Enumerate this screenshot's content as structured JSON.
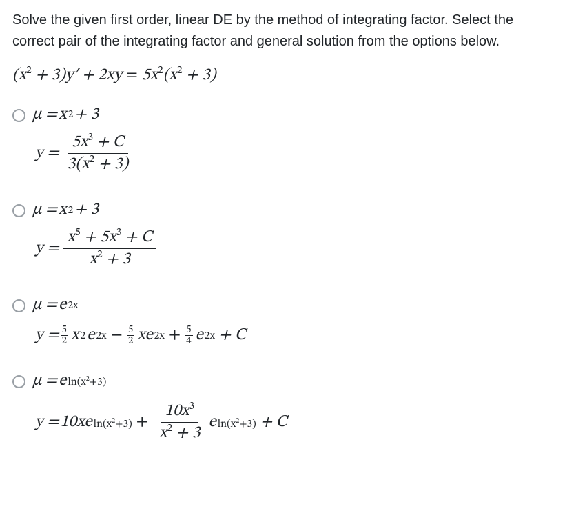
{
  "question": {
    "line1": "Solve the given first order, linear DE by the method of integrating factor. Select the",
    "line2": "correct pair of the integrating factor and general solution from the options below."
  },
  "equation": {
    "lhs_a": "(x",
    "lhs_a_sup": "2",
    "lhs_b": " + 3)y′ + 2xy",
    "eq": " = ",
    "rhs_a": "5x",
    "rhs_a_sup": "2",
    "rhs_b": "(x",
    "rhs_b_sup": "2",
    "rhs_c": " + 3)"
  },
  "options": [
    {
      "id": "opt1",
      "mu_lhs": "μ = ",
      "mu_rhs_a": "x",
      "mu_rhs_a_sup": "2",
      "mu_rhs_b": " + 3",
      "y_lhs": "y = ",
      "frac_num_a": "5x",
      "frac_num_a_sup": "3",
      "frac_num_b": " + C",
      "frac_den_a": "3(x",
      "frac_den_a_sup": "2",
      "frac_den_b": " + 3)"
    },
    {
      "id": "opt2",
      "mu_lhs": "μ = ",
      "mu_rhs_a": "x",
      "mu_rhs_a_sup": "2",
      "mu_rhs_b": " + 3",
      "y_lhs": "y = ",
      "frac_num_a": "x",
      "frac_num_a_sup": "5",
      "frac_num_b": " + 5x",
      "frac_num_b_sup": "3",
      "frac_num_c": " + C",
      "frac_den_a": "x",
      "frac_den_a_sup": "2",
      "frac_den_b": " + 3"
    },
    {
      "id": "opt3",
      "mu_lhs": "μ = ",
      "mu_e": "e",
      "mu_e_sup": "2x",
      "y_lhs": "y = ",
      "t1_coef_n": "5",
      "t1_coef_d": "2",
      "t1_a": "x",
      "t1_a_sup": "2",
      "t1_e": "e",
      "t1_e_sup": "2x",
      "minus": " − ",
      "t2_coef_n": "5",
      "t2_coef_d": "2",
      "t2_a": "xe",
      "t2_a_sup": "2x",
      "plus1": " + ",
      "t3_coef_n": "5",
      "t3_coef_d": "4",
      "t3_e": "e",
      "t3_e_sup": "2x",
      "plus2": " + C"
    },
    {
      "id": "opt4",
      "mu_lhs": "μ = ",
      "mu_e": "e",
      "mu_e_sup_a": "ln(x",
      "mu_e_sup_a_sup": "2",
      "mu_e_sup_b": "+3)",
      "y_lhs": "y = ",
      "t1_a": "10xe",
      "t1_sup_a": "ln(x",
      "t1_sup_a_sup": "2",
      "t1_sup_b": "+3)",
      "plus": " + ",
      "frac_num_a": "10x",
      "frac_num_a_sup": "3",
      "frac_den_a": "x",
      "frac_den_a_sup": "2",
      "frac_den_b": " + 3",
      "t2_e": "e",
      "t2_sup_a": "ln(x",
      "t2_sup_a_sup": "2",
      "t2_sup_b": "+3)",
      "tail": " + C"
    }
  ]
}
